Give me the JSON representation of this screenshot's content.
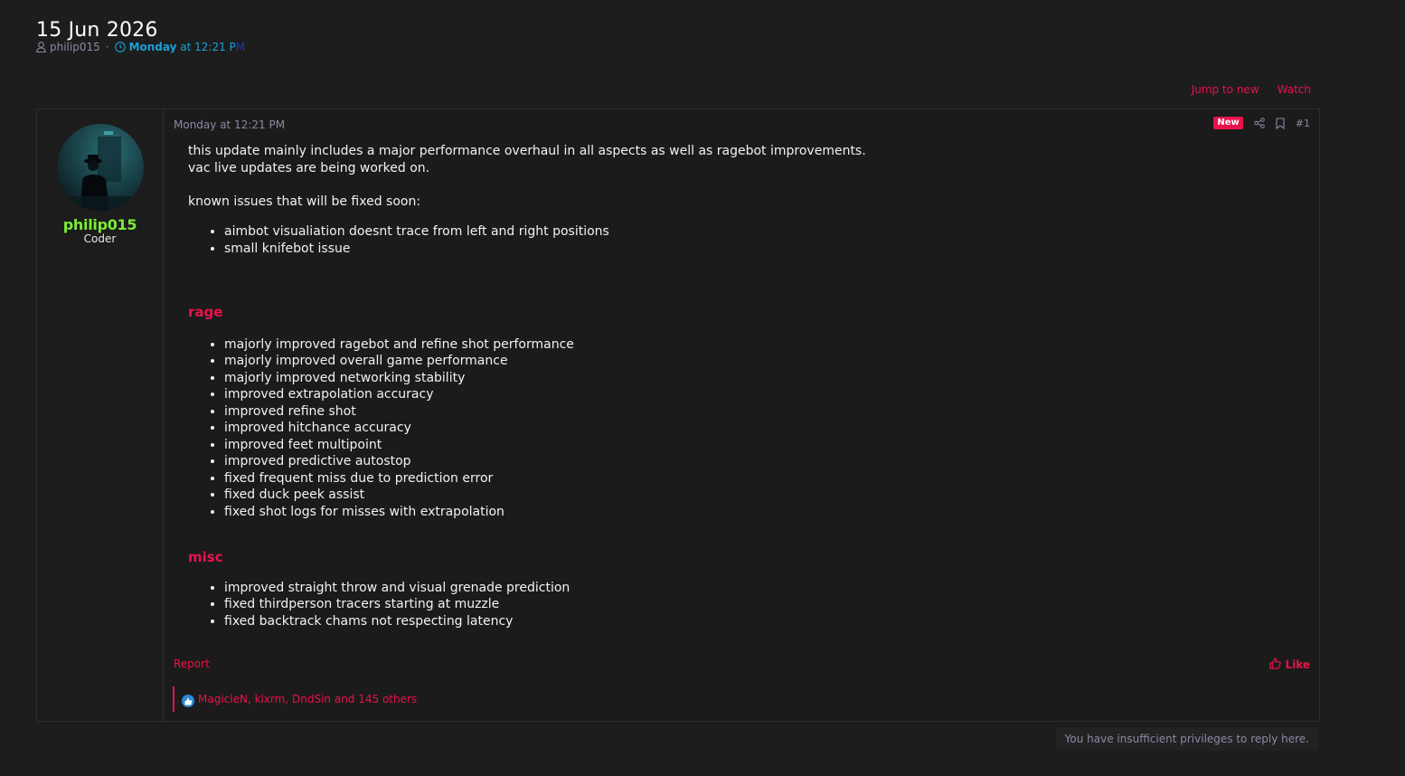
{
  "thread": {
    "title": "15 Jun 2026",
    "author": "philip015",
    "meta_sep": "·",
    "date_day": "Monday",
    "date_time_main": "at 12:21 P",
    "date_time_fade": "M"
  },
  "thread_actions": {
    "jump_to_new": "Jump to new",
    "watch": "Watch"
  },
  "post": {
    "username": "philip015",
    "user_title": "Coder",
    "date": "Monday at 12:21 PM",
    "badge": "New",
    "number": "#1",
    "intro_line1": "this update mainly includes a major performance overhaul in all aspects as well as ragebot improvements.",
    "intro_line2": "vac live updates are being worked on.",
    "known_issues_heading": "known issues that will be fixed soon:",
    "known_issues": [
      "aimbot visualiation doesnt trace from left and right positions",
      "small knifebot issue"
    ],
    "rage_heading": "rage",
    "rage_items": [
      "majorly improved ragebot and refine shot performance",
      "majorly improved overall game performance",
      "majorly improved networking stability",
      "improved extrapolation accuracy",
      "improved refine shot",
      "improved hitchance accuracy",
      "improved feet multipoint",
      "improved predictive autostop",
      "fixed frequent miss due to prediction error",
      "fixed duck peek assist",
      "fixed shot logs for misses with extrapolation"
    ],
    "misc_heading": "misc",
    "misc_items": [
      "improved straight throw and visual grenade prediction",
      "fixed thirdperson tracers starting at muzzle",
      "fixed backtrack chams not respecting latency"
    ],
    "report_label": "Report",
    "like_label": "Like",
    "reactions_text": "MagicleN, klxrm, DndSin and 145 others"
  },
  "reply_notice": "You have insufficient privileges to reply here.",
  "colors": {
    "accent": "#e8134b",
    "username": "#7bea3a",
    "link_blue": "#1aa0d6",
    "background": "#1d1d1d"
  }
}
